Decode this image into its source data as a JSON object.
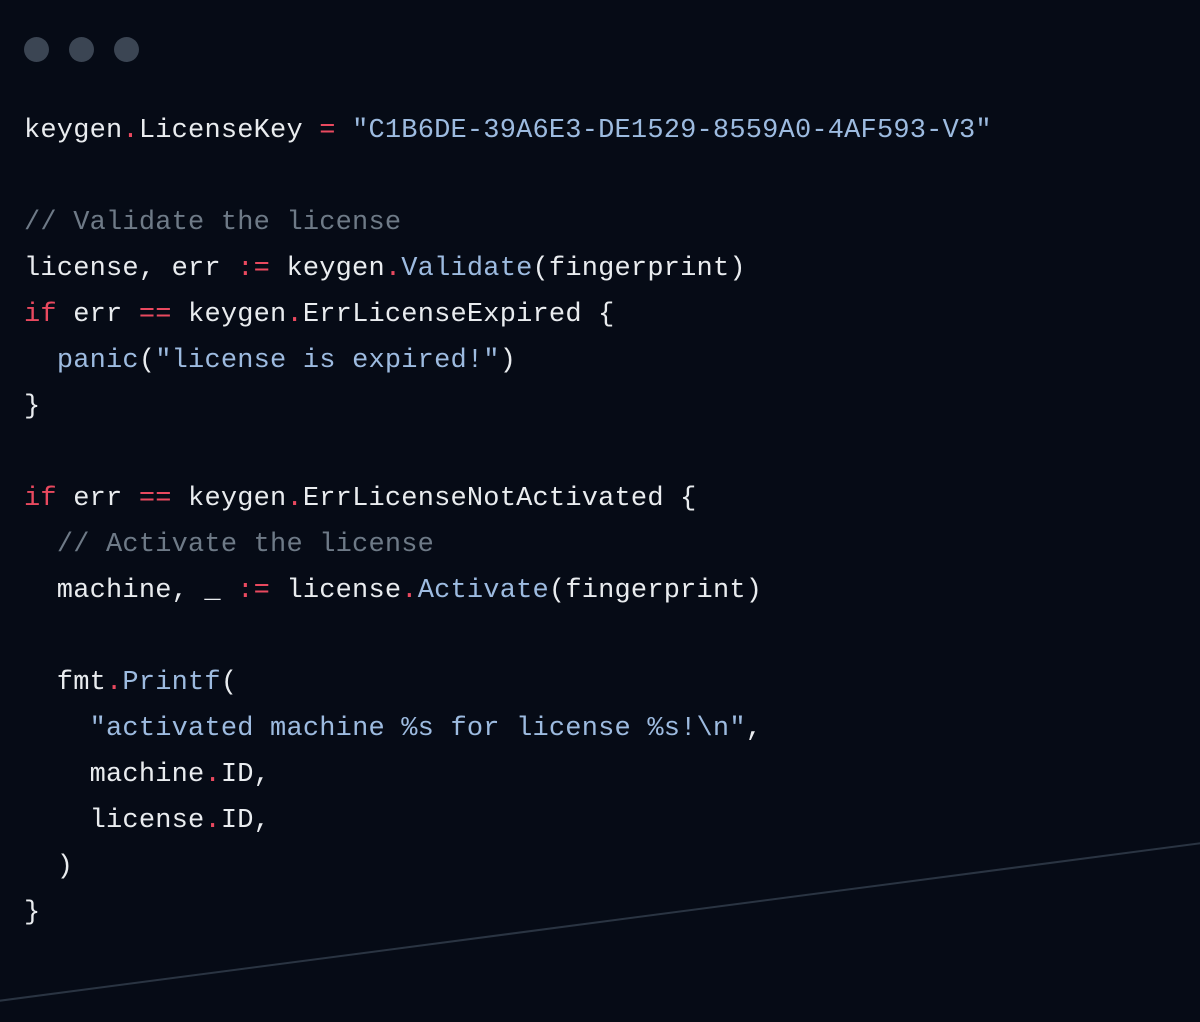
{
  "titlebar": {
    "dot1_color": "#3b4553",
    "dot2_color": "#3b4553",
    "dot3_color": "#3b4553"
  },
  "code": {
    "line1": {
      "a": "keygen",
      "b": ".",
      "c": "LicenseKey ",
      "d": "=",
      "e": " ",
      "f": "\"C1B6DE-39A6E3-DE1529-8559A0-4AF593-V3\""
    },
    "line3": "// Validate the license",
    "line4": {
      "a": "license, err ",
      "b": ":=",
      "c": " keygen",
      "d": ".",
      "e": "Validate",
      "f": "(fingerprint)"
    },
    "line5": {
      "a": "if",
      "b": " err ",
      "c": "==",
      "d": " keygen",
      "e": ".",
      "f": "ErrLicenseExpired {"
    },
    "line6": {
      "a": "  ",
      "b": "panic",
      "c": "(",
      "d": "\"license is expired!\"",
      "e": ")"
    },
    "line7": "}",
    "line9": {
      "a": "if",
      "b": " err ",
      "c": "==",
      "d": " keygen",
      "e": ".",
      "f": "ErrLicenseNotActivated {"
    },
    "line10": {
      "a": "  ",
      "b": "// Activate the license"
    },
    "line11": {
      "a": "  machine, _ ",
      "b": ":=",
      "c": " license",
      "d": ".",
      "e": "Activate",
      "f": "(fingerprint)"
    },
    "line13": {
      "a": "  fmt",
      "b": ".",
      "c": "Printf",
      "d": "("
    },
    "line14": {
      "a": "    ",
      "b": "\"activated machine %s for license %s!\\n\"",
      "c": ","
    },
    "line15": {
      "a": "    machine",
      "b": ".",
      "c": "ID,"
    },
    "line16": {
      "a": "    license",
      "b": ".",
      "c": "ID,"
    },
    "line17": "  )",
    "line18": "}"
  }
}
